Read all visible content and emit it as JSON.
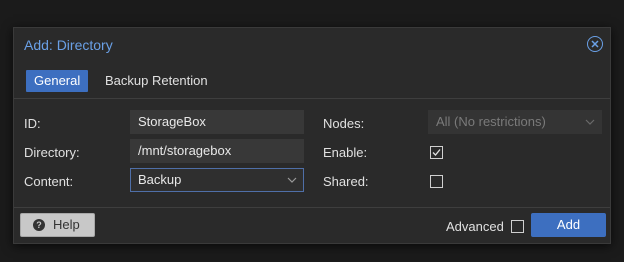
{
  "dialog": {
    "title": "Add: Directory"
  },
  "tabs": [
    {
      "label": "General",
      "active": true
    },
    {
      "label": "Backup Retention",
      "active": false
    }
  ],
  "form": {
    "id_label": "ID:",
    "id_value": "StorageBox",
    "directory_label": "Directory:",
    "directory_value": "/mnt/storagebox",
    "content_label": "Content:",
    "content_value": "Backup",
    "nodes_label": "Nodes:",
    "nodes_value": "All (No restrictions)",
    "enable_label": "Enable:",
    "enable_checked": true,
    "shared_label": "Shared:",
    "shared_checked": false
  },
  "footer": {
    "help_label": "Help",
    "advanced_label": "Advanced",
    "advanced_checked": false,
    "add_label": "Add"
  },
  "colors": {
    "accent": "#3d6fc0",
    "title": "#6aa0e6"
  },
  "icons": {
    "close": "close-circle-icon",
    "help": "question-circle-icon",
    "dropdown": "chevron-down-icon",
    "check": "check-icon"
  }
}
